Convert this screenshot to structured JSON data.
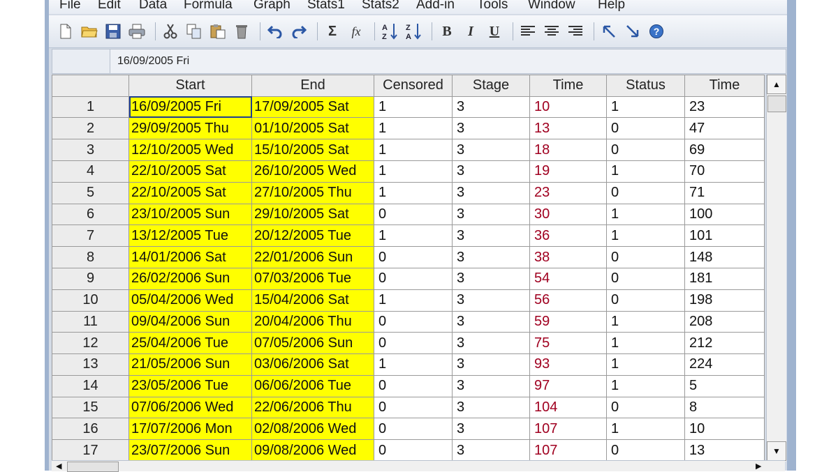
{
  "menu": [
    "File",
    "Edit",
    "Data",
    "Formula",
    "Graph",
    "Stats1",
    "Stats2",
    "Add-in",
    "Tools",
    "Window",
    "Help"
  ],
  "toolbar": {
    "sum_label": "Σ",
    "fx_label": "fx",
    "bold_label": "B",
    "italic_label": "I",
    "underline_label": "U"
  },
  "cell_bar": {
    "content": "16/09/2005 Fri"
  },
  "grid": {
    "headers": [
      "Start",
      "End",
      "Censored",
      "Stage",
      "Time",
      "Status",
      "Time"
    ],
    "rows": [
      {
        "n": "1",
        "start": "16/09/2005 Fri",
        "end": "17/09/2005 Sat",
        "censored": "1",
        "stage": "3",
        "time": "10",
        "status": "1",
        "time2": "23"
      },
      {
        "n": "2",
        "start": "29/09/2005 Thu",
        "end": "01/10/2005 Sat",
        "censored": "1",
        "stage": "3",
        "time": "13",
        "status": "0",
        "time2": "47"
      },
      {
        "n": "3",
        "start": "12/10/2005 Wed",
        "end": "15/10/2005 Sat",
        "censored": "1",
        "stage": "3",
        "time": "18",
        "status": "0",
        "time2": "69"
      },
      {
        "n": "4",
        "start": "22/10/2005 Sat",
        "end": "26/10/2005 Wed",
        "censored": "1",
        "stage": "3",
        "time": "19",
        "status": "1",
        "time2": "70"
      },
      {
        "n": "5",
        "start": "22/10/2005 Sat",
        "end": "27/10/2005 Thu",
        "censored": "1",
        "stage": "3",
        "time": "23",
        "status": "0",
        "time2": "71"
      },
      {
        "n": "6",
        "start": "23/10/2005 Sun",
        "end": "29/10/2005 Sat",
        "censored": "0",
        "stage": "3",
        "time": "30",
        "status": "1",
        "time2": "100"
      },
      {
        "n": "7",
        "start": "13/12/2005 Tue",
        "end": "20/12/2005 Tue",
        "censored": "1",
        "stage": "3",
        "time": "36",
        "status": "1",
        "time2": "101"
      },
      {
        "n": "8",
        "start": "14/01/2006 Sat",
        "end": "22/01/2006 Sun",
        "censored": "0",
        "stage": "3",
        "time": "38",
        "status": "0",
        "time2": "148"
      },
      {
        "n": "9",
        "start": "26/02/2006 Sun",
        "end": "07/03/2006 Tue",
        "censored": "0",
        "stage": "3",
        "time": "54",
        "status": "0",
        "time2": "181"
      },
      {
        "n": "10",
        "start": "05/04/2006 Wed",
        "end": "15/04/2006 Sat",
        "censored": "1",
        "stage": "3",
        "time": "56",
        "status": "0",
        "time2": "198"
      },
      {
        "n": "11",
        "start": "09/04/2006 Sun",
        "end": "20/04/2006 Thu",
        "censored": "0",
        "stage": "3",
        "time": "59",
        "status": "1",
        "time2": "208"
      },
      {
        "n": "12",
        "start": "25/04/2006 Tue",
        "end": "07/05/2006 Sun",
        "censored": "0",
        "stage": "3",
        "time": "75",
        "status": "1",
        "time2": "212"
      },
      {
        "n": "13",
        "start": "21/05/2006 Sun",
        "end": "03/06/2006 Sat",
        "censored": "1",
        "stage": "3",
        "time": "93",
        "status": "1",
        "time2": "224"
      },
      {
        "n": "14",
        "start": "23/05/2006 Tue",
        "end": "06/06/2006 Tue",
        "censored": "0",
        "stage": "3",
        "time": "97",
        "status": "1",
        "time2": "5"
      },
      {
        "n": "15",
        "start": "07/06/2006 Wed",
        "end": "22/06/2006 Thu",
        "censored": "0",
        "stage": "3",
        "time": "104",
        "status": "0",
        "time2": "8"
      },
      {
        "n": "16",
        "start": "17/07/2006 Mon",
        "end": "02/08/2006 Wed",
        "censored": "0",
        "stage": "3",
        "time": "107",
        "status": "1",
        "time2": "10"
      },
      {
        "n": "17",
        "start": "23/07/2006 Sun",
        "end": "09/08/2006 Wed",
        "censored": "0",
        "stage": "3",
        "time": "107",
        "status": "0",
        "time2": "13"
      }
    ]
  },
  "colors": {
    "date_fill": "#ffff00",
    "selection": "#1f3f8f",
    "time_text": "#a00020",
    "window_frame": "#9fb3cf"
  }
}
